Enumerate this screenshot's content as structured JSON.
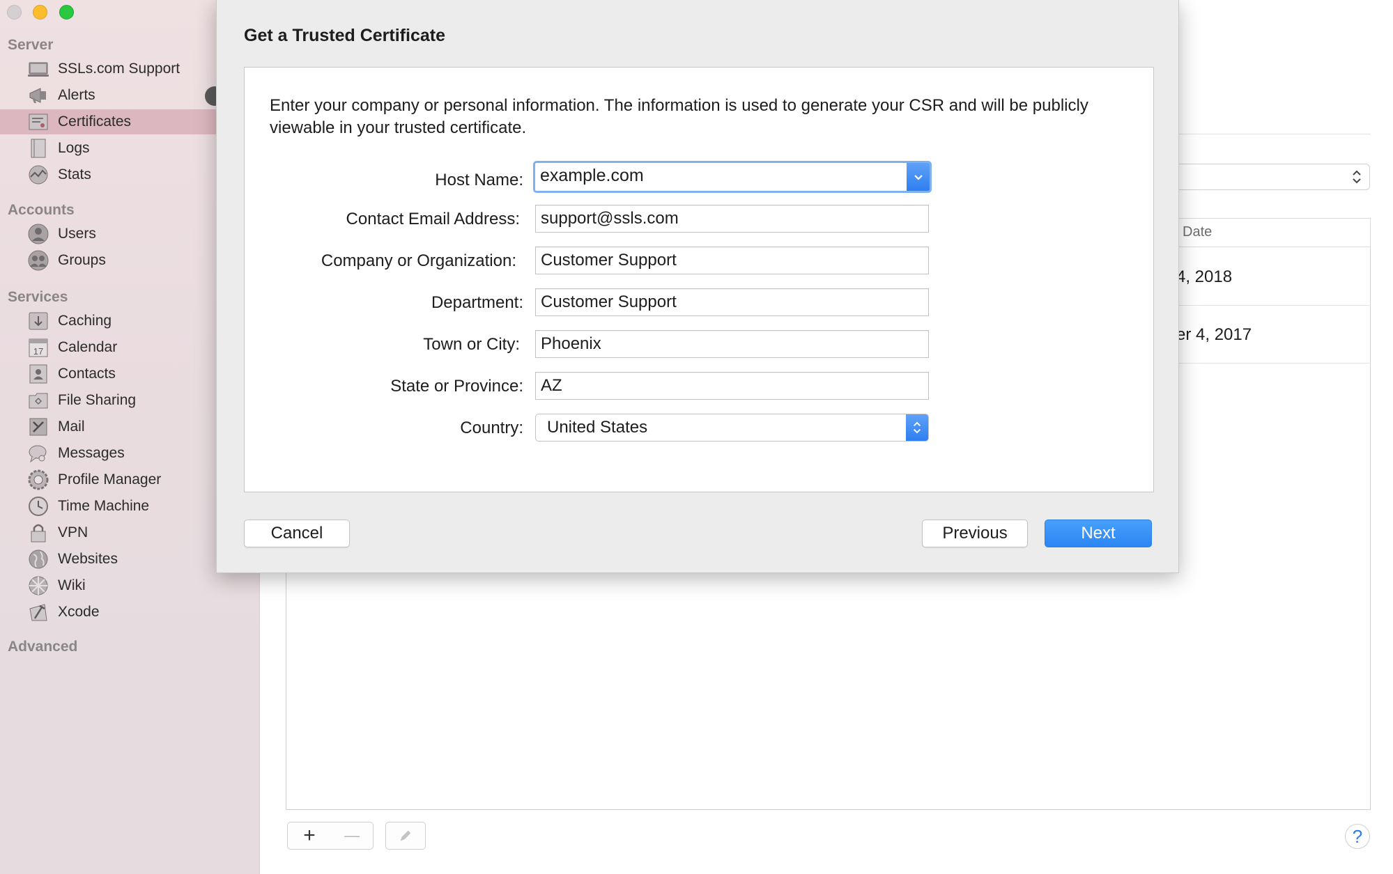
{
  "sidebar": {
    "sections": {
      "server": "Server",
      "accounts": "Accounts",
      "services": "Services",
      "advanced": "Advanced"
    },
    "server_items": [
      {
        "label": "SSLs.com Support",
        "icon": "computer-icon"
      },
      {
        "label": "Alerts",
        "icon": "megaphone-icon"
      },
      {
        "label": "Certificates",
        "icon": "certificate-icon"
      },
      {
        "label": "Logs",
        "icon": "document-icon"
      },
      {
        "label": "Stats",
        "icon": "stats-icon"
      }
    ],
    "account_items": [
      {
        "label": "Users",
        "icon": "user-icon"
      },
      {
        "label": "Groups",
        "icon": "group-icon"
      }
    ],
    "service_items": [
      {
        "label": "Caching",
        "icon": "download-icon"
      },
      {
        "label": "Calendar",
        "icon": "calendar-icon"
      },
      {
        "label": "Contacts",
        "icon": "contacts-icon"
      },
      {
        "label": "File Sharing",
        "icon": "folder-icon"
      },
      {
        "label": "Mail",
        "icon": "mail-icon"
      },
      {
        "label": "Messages",
        "icon": "messages-icon"
      },
      {
        "label": "Profile Manager",
        "icon": "gear-icon"
      },
      {
        "label": "Time Machine",
        "icon": "clock-icon"
      },
      {
        "label": "VPN",
        "icon": "lock-icon"
      },
      {
        "label": "Websites",
        "icon": "globe-icon"
      },
      {
        "label": "Wiki",
        "icon": "wiki-icon"
      },
      {
        "label": "Xcode",
        "icon": "hammer-icon"
      }
    ],
    "selected": "Certificates",
    "calendar_day": "17",
    "badge_color": "#5a5a5a",
    "selected_color": "#dcb7bf"
  },
  "background_table": {
    "column_header": "Date",
    "rows": [
      "4, 2018",
      "er 4, 2017"
    ]
  },
  "bottom_bar": {
    "add_label": "+",
    "remove_label": "—",
    "help_label": "?"
  },
  "dialog": {
    "title": "Get a Trusted Certificate",
    "intro": "Enter your company or personal information. The information is used to generate your CSR and will be publicly viewable in your trusted certificate.",
    "fields": {
      "host_name": {
        "label": "Host Name:",
        "value": "example.com"
      },
      "email": {
        "label": "Contact Email Address:",
        "value": "support@ssls.com"
      },
      "company": {
        "label": "Company or Organization:",
        "value": "Customer Support"
      },
      "department": {
        "label": "Department:",
        "value": "Customer Support"
      },
      "city": {
        "label": "Town or City:",
        "value": "Phoenix"
      },
      "state": {
        "label": "State or Province:",
        "value": "AZ"
      },
      "country": {
        "label": "Country:",
        "value": "United States"
      }
    },
    "buttons": {
      "cancel": "Cancel",
      "previous": "Previous",
      "next": "Next"
    },
    "accent_color": "#2b86f4"
  }
}
